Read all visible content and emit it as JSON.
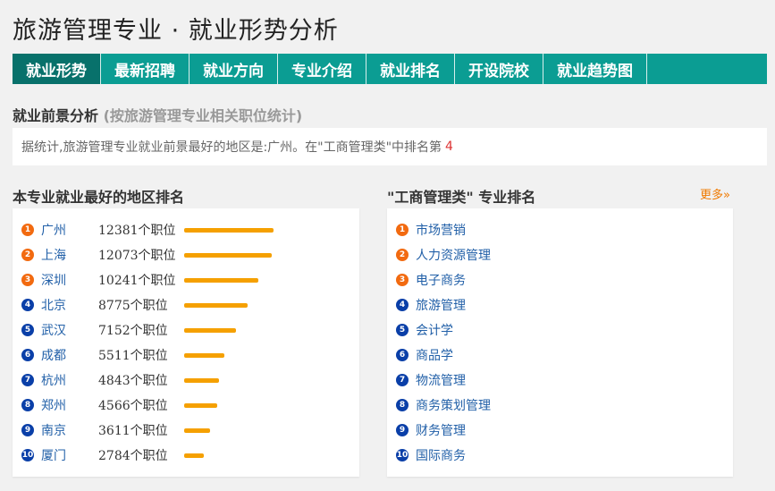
{
  "page_title": "旅游管理专业 · 就业形势分析",
  "tabs": [
    {
      "label": "就业形势"
    },
    {
      "label": "最新招聘"
    },
    {
      "label": "就业方向"
    },
    {
      "label": "专业介绍"
    },
    {
      "label": "就业排名"
    },
    {
      "label": "开设院校"
    },
    {
      "label": "就业趋势图"
    }
  ],
  "prospect": {
    "title": "就业前景分析",
    "subtitle": "(按旅游管理专业相关职位统计)",
    "text": "据统计,旅游管理专业就业前景最好的地区是:广州。在\"工商管理类\"中排名第",
    "rank": "4"
  },
  "regions": {
    "heading": "本专业就业最好的地区排名",
    "items": [
      {
        "num": "1",
        "city": "广州",
        "count": "12381个职位",
        "value": 12381
      },
      {
        "num": "2",
        "city": "上海",
        "count": "12073个职位",
        "value": 12073
      },
      {
        "num": "3",
        "city": "深圳",
        "count": "10241个职位",
        "value": 10241
      },
      {
        "num": "4",
        "city": "北京",
        "count": "8775个职位",
        "value": 8775
      },
      {
        "num": "5",
        "city": "武汉",
        "count": "7152个职位",
        "value": 7152
      },
      {
        "num": "6",
        "city": "成都",
        "count": "5511个职位",
        "value": 5511
      },
      {
        "num": "7",
        "city": "杭州",
        "count": "4843个职位",
        "value": 4843
      },
      {
        "num": "8",
        "city": "郑州",
        "count": "4566个职位",
        "value": 4566
      },
      {
        "num": "9",
        "city": "南京",
        "count": "3611个职位",
        "value": 3611
      },
      {
        "num": "10",
        "city": "厦门",
        "count": "2784个职位",
        "value": 2784
      }
    ]
  },
  "majors": {
    "heading": "\"工商管理类\" 专业排名",
    "more": "更多»",
    "items": [
      {
        "num": "1",
        "name": "市场营销"
      },
      {
        "num": "2",
        "name": "人力资源管理"
      },
      {
        "num": "3",
        "name": "电子商务"
      },
      {
        "num": "4",
        "name": "旅游管理"
      },
      {
        "num": "5",
        "name": "会计学"
      },
      {
        "num": "6",
        "name": "商品学"
      },
      {
        "num": "7",
        "name": "物流管理"
      },
      {
        "num": "8",
        "name": "商务策划管理"
      },
      {
        "num": "9",
        "name": "财务管理"
      },
      {
        "num": "10",
        "name": "国际商务"
      }
    ]
  },
  "colors": {
    "tab_bg": "#0b9d93",
    "tab_active": "#08716b",
    "bar": "#f5a000",
    "badge_top": "#f26a10",
    "badge_rest": "#0a3fa8"
  }
}
